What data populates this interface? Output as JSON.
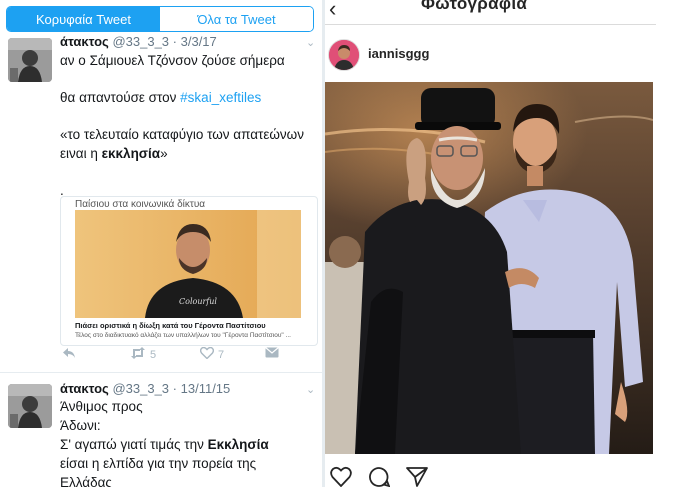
{
  "twitter": {
    "tabs": {
      "top": "Κορυφαία Tweet",
      "all": "Όλα τα Tweet"
    },
    "tweet1": {
      "name": "άτακτος",
      "handle": "@33_3_3",
      "date": "3/3/17",
      "line1": "αν ο Σάμιουελ Τζόνσον ζούσε σήμερα",
      "line2_prefix": "θα απαντούσε στον ",
      "hashtag": "#skai_xeftiles",
      "line3": "«το τελευταίο καταφύγιο των απατεώνων",
      "line4_prefix": "ειναι η ",
      "line4_bold": "εκκλησία",
      "line4_suffix": "»",
      "dot": ".",
      "card": {
        "top_text": "Παίσιου στα κοινωνικά δίκτυα",
        "title": "Πιάσει οριστικά η δίωξη κατά του Γέροντα Παστίτσιου",
        "subtitle": "Τέλος στο διαδικτυακό αλλάζει των υπαλλήλων του \"Γέροντα Παστίτσιου\" ...",
        "shirt_text": "Colourful"
      },
      "actions": {
        "retweets": "5",
        "likes": "7"
      }
    },
    "tweet2": {
      "name": "άτακτος",
      "handle": "@33_3_3",
      "date": "13/11/15",
      "line1": "Άνθιμος προς",
      "line2": "Άδωνι:",
      "line3_prefix": "Σ' αγαπώ γιατί τιμάς την ",
      "line3_bold": "Εκκλησία",
      "line4": "είσαι η ελπίδα για την πορεία της",
      "line5": "Ελλάδας"
    }
  },
  "instagram": {
    "back_icon": "chevron-left-icon",
    "title": "Φωτογραφία",
    "username": "iannisggg",
    "icons": [
      "heart-icon",
      "comment-icon",
      "share-icon"
    ]
  },
  "colors": {
    "twitter_blue": "#1da1f2",
    "gray_text": "#657786"
  }
}
